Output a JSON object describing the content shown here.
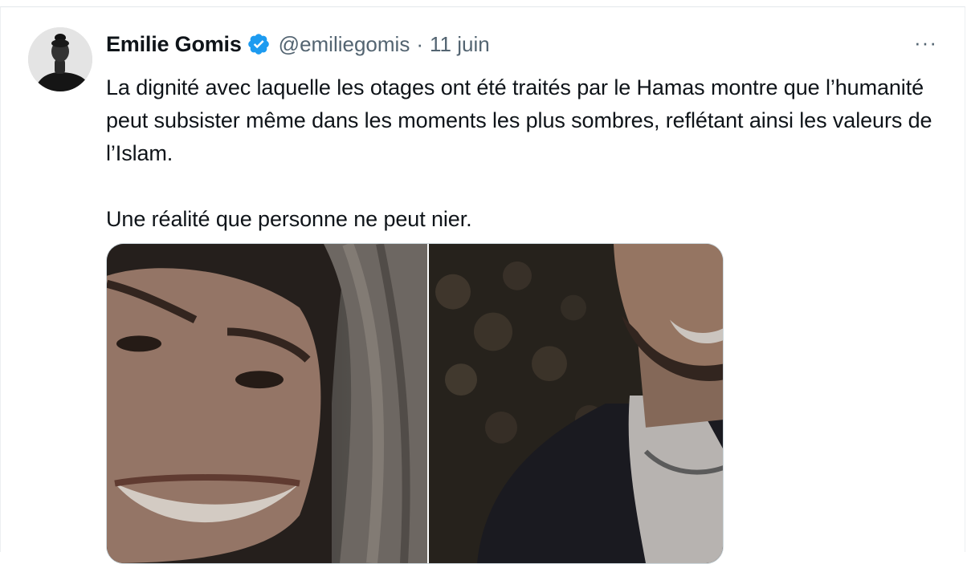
{
  "tweet": {
    "author_name": "Emilie Gomis",
    "handle": "@emiliegomis",
    "separator": "·",
    "date": "11 juin",
    "more_label": "···",
    "text_paragraphs": [
      "La dignité avec laquelle les otages ont été traités par le Hamas montre que l’humanité peut subsister même dans les moments les plus sombres, reflétant ainsi les valeurs de l’Islam.",
      "Une réalité que personne ne peut nier."
    ]
  },
  "icons": {
    "verified": "verified-badge-icon",
    "more": "more-options-icon"
  },
  "colors": {
    "text_primary": "#0f1419",
    "text_secondary": "#536471",
    "verified_blue": "#1d9bf0",
    "border": "#cfd9de"
  }
}
